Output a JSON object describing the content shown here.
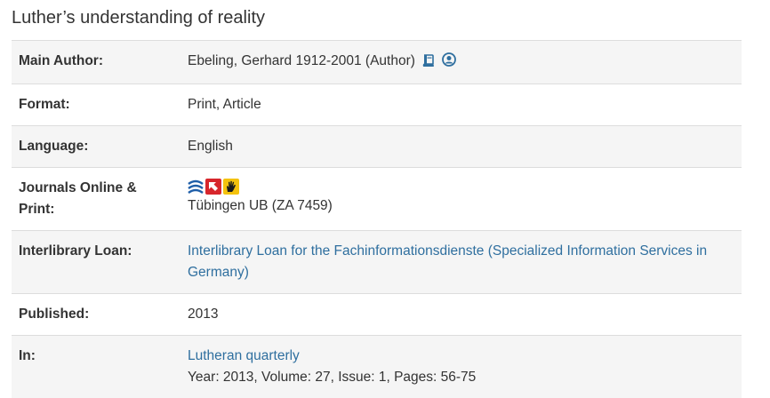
{
  "page": {
    "title": "Luther’s understanding of reality"
  },
  "rows": {
    "main_author": {
      "label": "Main Author:",
      "value": "Ebeling, Gerhard 1912-2001 (Author)",
      "icons": [
        "book-icon",
        "user-circle-icon"
      ]
    },
    "format": {
      "label": "Format:",
      "value": "Print, Article"
    },
    "language": {
      "label": "Language:",
      "value": "English"
    },
    "journals": {
      "label_line1": "Journals Online &",
      "label_line2": "Print:",
      "icons": [
        "ezb-wave-icon",
        "arrow-red-icon",
        "hand-yellow-icon"
      ],
      "value": "Tübingen UB (ZA 7459)"
    },
    "ill": {
      "label": "Interlibrary Loan:",
      "link_line1": "Interlibrary Loan for the Fachinformationsdienste (Specialized Information Services in",
      "link_line2": "Germany)"
    },
    "published": {
      "label": "Published:",
      "value": "2013"
    },
    "in": {
      "label": "In:",
      "link": "Lutheran quarterly",
      "details": "Year: 2013, Volume: 27, Issue: 1, Pages: 56-75"
    }
  },
  "colors": {
    "link": "#2f6f9f",
    "row_alt": "#f5f5f5",
    "border": "#dddddd",
    "text": "#333333"
  }
}
